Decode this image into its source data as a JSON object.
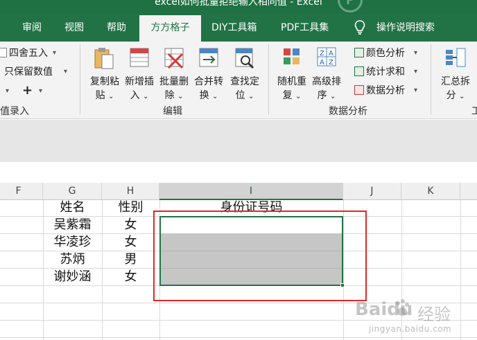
{
  "window": {
    "title": "excel如何批量拒绝输入相同值 - Excel"
  },
  "tabs": {
    "review": "审阅",
    "view": "视图",
    "help": "帮助",
    "fangfang": "方方格子",
    "diy": "DIY工具箱",
    "pdf": "PDF工具集",
    "tell_me": "操作说明搜索",
    "active": "方方格子"
  },
  "ribbon": {
    "round": "四舍五入",
    "keep_values": "只保留数值",
    "plus": "+",
    "value_entry_group": "值录入",
    "copy_paste": {
      "line1": "复制粘",
      "line2": "贴"
    },
    "add_insert": {
      "line1": "新增插",
      "line2": "入"
    },
    "batch_delete": {
      "line1": "批量删",
      "line2": "除"
    },
    "merge_convert": {
      "line1": "合并转",
      "line2": "换"
    },
    "find_locate": {
      "line1": "查找定",
      "line2": "位"
    },
    "edit_group": "编辑",
    "random_dup": {
      "line1": "随机重",
      "line2": "复"
    },
    "advanced_sort": {
      "line1": "高级排",
      "line2": "序"
    },
    "color_analysis": "颜色分析",
    "stats_sum": "统计求和",
    "data_analysis_btn": "数据分析",
    "data_analysis_group": "数据分析",
    "summary_split": {
      "line1": "汇总拆",
      "line2": "分"
    }
  },
  "sheet": {
    "columns": [
      "F",
      "G",
      "H",
      "I",
      "J",
      "K"
    ],
    "selected_column": "I",
    "header_row": {
      "name": "姓名",
      "gender": "性别",
      "id": "身份证号码"
    },
    "rows": [
      {
        "name": "吴紫霜",
        "gender": "女"
      },
      {
        "name": "华凌珍",
        "gender": "女"
      },
      {
        "name": "苏炳",
        "gender": "男"
      },
      {
        "name": "谢妙涵",
        "gender": "女"
      }
    ]
  },
  "watermark": {
    "brand": "Baidu",
    "product": "经验",
    "url": "jingyan.baidu.com"
  },
  "colors": {
    "excel_green": "#217346",
    "highlight_red": "#e02727",
    "selection_gray": "#c6c6c6"
  }
}
